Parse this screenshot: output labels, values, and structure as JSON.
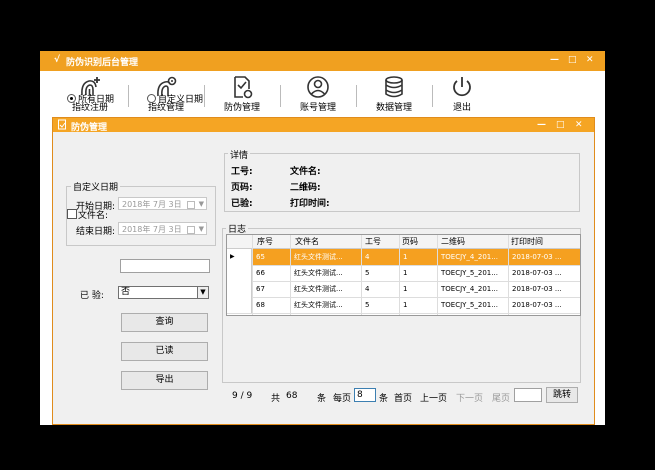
{
  "window": {
    "title": "防伪识别后台管理",
    "icon_label": "√",
    "controls": [
      "—",
      "□",
      "✕"
    ]
  },
  "toolbar": [
    {
      "label": "指纹注册",
      "icon": "fingerprint-add-icon"
    },
    {
      "label": "指纹管理",
      "icon": "fingerprint-gear-icon"
    },
    {
      "label": "防伪管理",
      "icon": "doc-check-icon"
    },
    {
      "label": "账号管理",
      "icon": "user-icon"
    },
    {
      "label": "数据管理",
      "icon": "database-icon"
    },
    {
      "label": "退出",
      "icon": "power-icon"
    }
  ],
  "child": {
    "title": "防伪管理",
    "controls": [
      "—",
      "□",
      "✕"
    ]
  },
  "filter": {
    "radio_all": "所有日期",
    "radio_custom": "自定义日期",
    "radio_selected": "all",
    "custom_group": "自定义日期",
    "start_label": "开始日期:",
    "start_value": "2018年 7月 3日",
    "end_label": "结束日期:",
    "end_value": "2018年 7月 3日",
    "filename_label": "文件名:",
    "verified_label": "已 验:",
    "verified_value": "否",
    "query": "查询",
    "read": "已读",
    "export": "导出"
  },
  "details": {
    "group": "详情",
    "job_no": "工号:",
    "file_name": "文件名:",
    "page_no": "页码:",
    "qr_code": "二维码:",
    "verified": "已验:",
    "print_time": "打印时间:"
  },
  "log": {
    "group": "日志",
    "columns": [
      "序号",
      "文件名",
      "工号",
      "页码",
      "二维码",
      "打印时间"
    ],
    "rows": [
      [
        "65",
        "红头文件测试...",
        "4",
        "1",
        "TOECJY_4_201...",
        "2018-07-03 ..."
      ],
      [
        "66",
        "红头文件测试...",
        "5",
        "1",
        "TOECJY_5_201...",
        "2018-07-03 ..."
      ],
      [
        "67",
        "红头文件测试...",
        "4",
        "1",
        "TOECJY_4_201...",
        "2018-07-03 ..."
      ],
      [
        "68",
        "红头文件测试...",
        "5",
        "1",
        "TOECJY_5_201...",
        "2018-07-03 ..."
      ]
    ],
    "selected_row": 0
  },
  "pager": {
    "page": "9 / 9",
    "total_label": "共",
    "total": "68",
    "unit": "条",
    "per_page_label": "每页",
    "per_page": "8",
    "unit2": "条",
    "first": "首页",
    "prev": "上一页",
    "next": "下一页",
    "last": "尾页",
    "jump": "跳转"
  },
  "colors": {
    "accent": "#f0a020",
    "selected_row": "#f5a020"
  }
}
